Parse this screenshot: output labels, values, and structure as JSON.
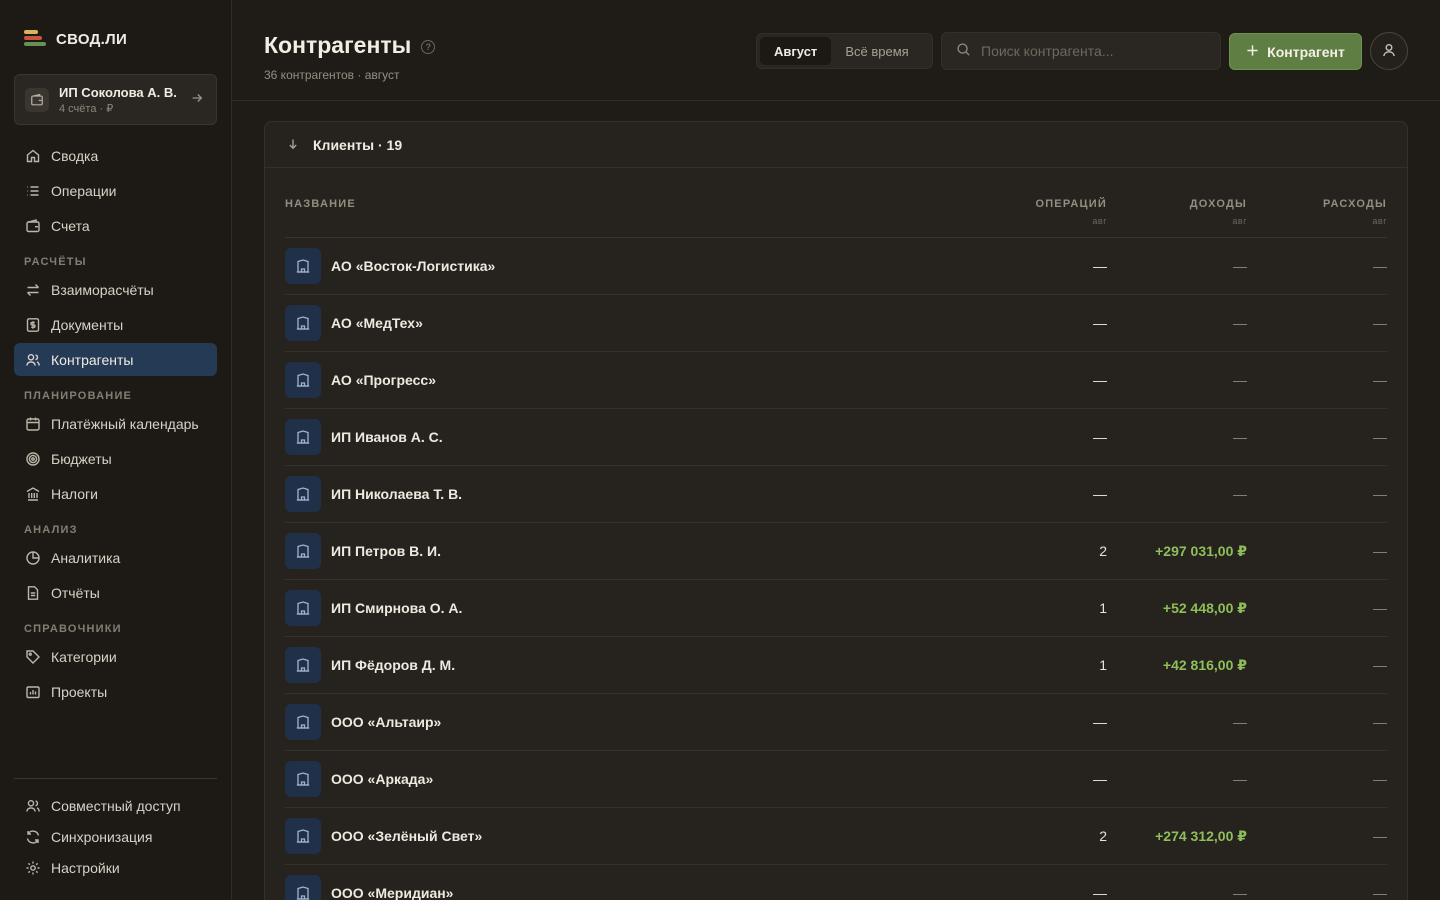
{
  "app": {
    "logo_text": "СВОД.ЛИ"
  },
  "account": {
    "name": "ИП Соколова А. В.",
    "sub": "4 счёта · ₽"
  },
  "nav": {
    "main": [
      {
        "label": "Сводка",
        "icon": "home-icon"
      },
      {
        "label": "Операции",
        "icon": "list-icon"
      },
      {
        "label": "Счета",
        "icon": "wallet-icon"
      }
    ],
    "sections": [
      {
        "title": "РАСЧЁТЫ",
        "items": [
          {
            "label": "Взаиморасчёты",
            "icon": "swap-icon"
          },
          {
            "label": "Документы",
            "icon": "document-dollar-icon"
          },
          {
            "label": "Контрагенты",
            "icon": "users-icon",
            "active": true
          }
        ]
      },
      {
        "title": "ПЛАНИРОВАНИЕ",
        "items": [
          {
            "label": "Платёжный календарь",
            "icon": "calendar-icon"
          },
          {
            "label": "Бюджеты",
            "icon": "target-icon"
          },
          {
            "label": "Налоги",
            "icon": "bank-icon"
          }
        ]
      },
      {
        "title": "АНАЛИЗ",
        "items": [
          {
            "label": "Аналитика",
            "icon": "pie-chart-icon"
          },
          {
            "label": "Отчёты",
            "icon": "report-icon"
          }
        ]
      },
      {
        "title": "СПРАВОЧНИКИ",
        "items": [
          {
            "label": "Категории",
            "icon": "tag-icon"
          },
          {
            "label": "Проекты",
            "icon": "folder-chart-icon"
          }
        ]
      }
    ],
    "footer": [
      {
        "label": "Совместный доступ",
        "icon": "share-users-icon"
      },
      {
        "label": "Синхронизация",
        "icon": "sync-icon"
      },
      {
        "label": "Настройки",
        "icon": "gear-icon"
      }
    ]
  },
  "header": {
    "title": "Контрагенты",
    "subtitle": "36 контрагентов · август",
    "period": {
      "options": [
        "Август",
        "Всё время"
      ],
      "selected": "Август"
    },
    "search_placeholder": "Поиск контрагента...",
    "add_label": "Контрагент"
  },
  "group": {
    "title": "Клиенты · 19"
  },
  "table": {
    "columns": {
      "name": "НАЗВАНИЕ",
      "ops": "ОПЕРАЦИЙ",
      "ops_sub": "авг",
      "income": "ДОХОДЫ",
      "income_sub": "авг",
      "expense": "РАСХОДЫ",
      "expense_sub": "авг"
    },
    "rows": [
      {
        "name": "АО «Восток-Логистика»",
        "ops": "—",
        "income": "—",
        "expense": "—"
      },
      {
        "name": "АО «МедТех»",
        "ops": "—",
        "income": "—",
        "expense": "—"
      },
      {
        "name": "АО «Прогресс»",
        "ops": "—",
        "income": "—",
        "expense": "—"
      },
      {
        "name": "ИП Иванов А. С.",
        "ops": "—",
        "income": "—",
        "expense": "—"
      },
      {
        "name": "ИП Николаева Т. В.",
        "ops": "—",
        "income": "—",
        "expense": "—"
      },
      {
        "name": "ИП Петров В. И.",
        "ops": "2",
        "income": "+297 031,00 ₽",
        "expense": "—"
      },
      {
        "name": "ИП Смирнова О. А.",
        "ops": "1",
        "income": "+52 448,00 ₽",
        "expense": "—"
      },
      {
        "name": "ИП Фёдоров Д. М.",
        "ops": "1",
        "income": "+42 816,00 ₽",
        "expense": "—"
      },
      {
        "name": "ООО «Альтаир»",
        "ops": "—",
        "income": "—",
        "expense": "—"
      },
      {
        "name": "ООО «Аркада»",
        "ops": "—",
        "income": "—",
        "expense": "—"
      },
      {
        "name": "ООО «Зелёный Свет»",
        "ops": "2",
        "income": "+274 312,00 ₽",
        "expense": "—"
      },
      {
        "name": "ООО «Меридиан»",
        "ops": "—",
        "income": "—",
        "expense": "—"
      }
    ]
  },
  "colors": {
    "accent_green": "#5e7e44",
    "active_nav": "#243a55",
    "income_positive": "#8fbf5a"
  }
}
